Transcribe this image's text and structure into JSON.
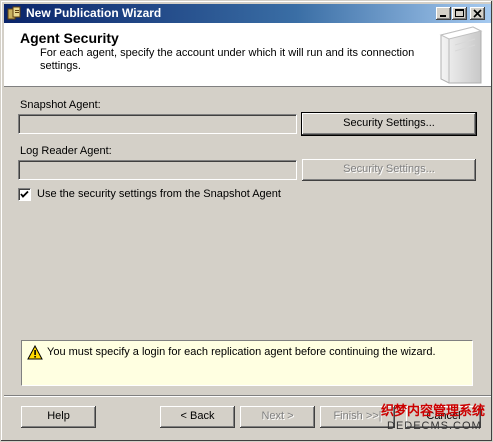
{
  "window": {
    "title": "New Publication Wizard"
  },
  "header": {
    "title": "Agent Security",
    "subtitle": "For each agent, specify the account under which it will run and its connection settings."
  },
  "snapshot_agent": {
    "label": "Snapshot Agent:",
    "value": "",
    "button": "Security Settings..."
  },
  "log_reader_agent": {
    "label": "Log Reader Agent:",
    "value": "",
    "button": "Security Settings..."
  },
  "use_snapshot_security": {
    "label": "Use the security settings from the Snapshot Agent",
    "checked": true
  },
  "message": {
    "text": "You must specify a login for each replication agent before continuing the wizard.",
    "icon": "warning-icon"
  },
  "footer": {
    "help": "Help",
    "back": "< Back",
    "next": "Next >",
    "finish": "Finish >>|",
    "cancel": "Cancel"
  },
  "watermark": {
    "cn": "织梦内容管理系统",
    "en": "DEDECMS.COM"
  }
}
